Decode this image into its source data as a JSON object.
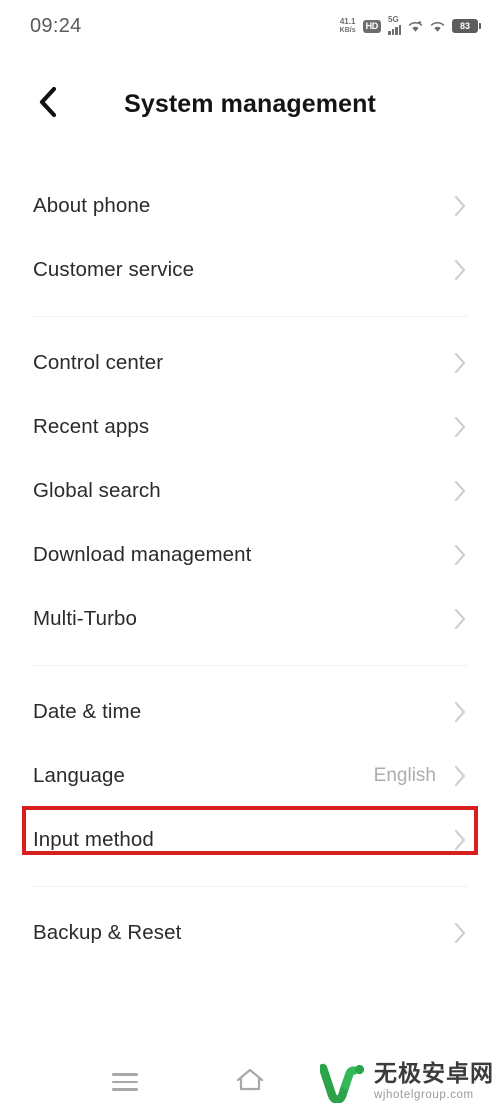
{
  "status_bar": {
    "time": "09:24",
    "net_speed_value": "41.1",
    "net_speed_unit": "KB/s",
    "hd_label": "HD",
    "network_type": "5G",
    "battery_level": "83"
  },
  "header": {
    "title": "System management",
    "back_icon": "chevron-left-icon"
  },
  "groups": [
    {
      "items": [
        {
          "label": "About phone",
          "value": ""
        },
        {
          "label": "Customer service",
          "value": ""
        }
      ]
    },
    {
      "items": [
        {
          "label": "Control center",
          "value": ""
        },
        {
          "label": "Recent apps",
          "value": ""
        },
        {
          "label": "Global search",
          "value": ""
        },
        {
          "label": "Download management",
          "value": ""
        },
        {
          "label": "Multi-Turbo",
          "value": ""
        }
      ]
    },
    {
      "items": [
        {
          "label": "Date & time",
          "value": ""
        },
        {
          "label": "Language",
          "value": "English"
        },
        {
          "label": "Input method",
          "value": ""
        }
      ]
    },
    {
      "items": [
        {
          "label": "Backup & Reset",
          "value": ""
        }
      ]
    }
  ],
  "highlight": {
    "target": "Language",
    "color": "#d81f1f"
  },
  "nav_bar": {
    "recents_icon": "hamburger-menu-icon",
    "home_icon": "home-icon"
  },
  "watermark": {
    "brand_cn": "无极安卓网",
    "url": "wjhotelgroup.com",
    "logo_color": "#2aa34a"
  },
  "colors": {
    "accent_red": "#d81f1f",
    "text_primary": "#2b2b2b",
    "text_secondary": "#adadad",
    "divider": "#f2f2f2",
    "background": "#ffffff"
  }
}
